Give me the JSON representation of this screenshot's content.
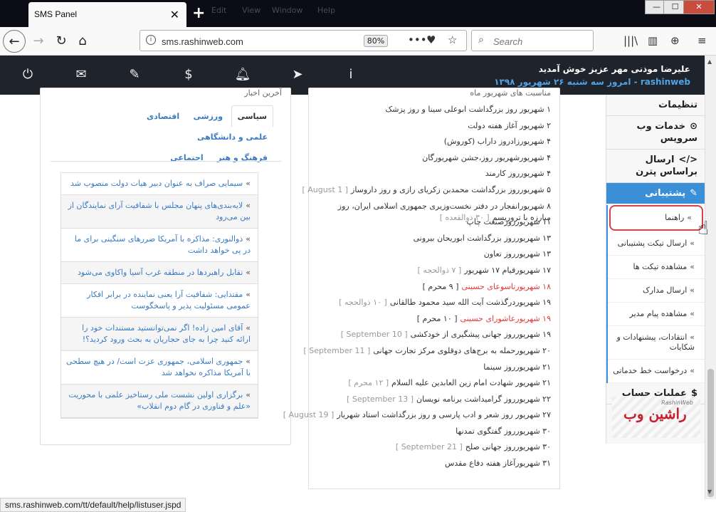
{
  "browser": {
    "tab_title": "SMS Panel",
    "tab_close": "✕",
    "new_tab": "+",
    "menu_items": [
      "Edit",
      "View",
      "Window",
      "Help"
    ],
    "window_controls": {
      "minimize": "—",
      "maximize": "☐",
      "close": "✕"
    },
    "url": "sms.rashinweb.com",
    "zoom": "80%",
    "search_placeholder": "Search",
    "status_url": "sms.rashinweb.com/tt/default/help/listuser.jspd"
  },
  "header": {
    "welcome": "علیرضا موذنی مهر عزیز خوش آمدید",
    "date_line": "rashinweb - امروز سه شنبه ۲۶ شهریور ۱۳۹۸",
    "icons": [
      "power-icon",
      "mail-icon",
      "ticket-icon",
      "dollar-icon",
      "bell-icon",
      "send-icon",
      "info-icon"
    ]
  },
  "news": {
    "title_stub": "آخرین اخبار",
    "tabs": [
      "سیاسی",
      "ورزشی",
      "اقتصادی",
      "علمی و دانشگاهی",
      "فرهنگ و هنر",
      "اجتماعی"
    ],
    "active_tab": 0,
    "items": [
      "سیمایی صراف به عنوان دبیر هیات دولت منصوب شد",
      "لایه‌بندی‌های پنهان مجلس با شفافیت آرای نمایندگان از بین می‌رود",
      "ذوالنوری: مذاکره با آمریکا ضررهای سنگینی برای ما در پی خواهد داشت",
      "تقابل راهبردها در منطقه غرب آسیا واکاوی می‌شود",
      "مقتدایی: شفافیت آرا یعنی نماینده در برابر افکار عمومی مسئولیت پذیر و پاسخگوست",
      "آقای امین زاده! اگر نمی‌توانستید مستندات خود را ارائه کنید چرا به جای حجاریان به بحث ورود کردید؟!",
      "جمهوری اسلامی، جمهوری عزت است/ در هیچ سطحی با آمریکا مذاکره نخواهد شد",
      "برگزاری اولین نشست ملی رستاخیز علمی با محوریت «علم و فناوری در گام دوم انقلاب»"
    ]
  },
  "events": {
    "title_stub": "مناسبت های شهریور ماه",
    "items": [
      {
        "text": "۱ شهریور روز بزرگداشت ابوعلی سینا و روز پزشک",
        "other": "",
        "holiday": false
      },
      {
        "text": "۲ شهریور آغاز هفته دولت",
        "other": "",
        "holiday": false
      },
      {
        "text": "۴ شهریورزادروز داراب (کوروش)",
        "other": "",
        "holiday": false
      },
      {
        "text": "۴ شهریورشهریور روز،جشن شهریورگان",
        "other": "",
        "holiday": false
      },
      {
        "text": "۴ شهریورروز کارمند",
        "other": "",
        "holiday": false
      },
      {
        "text": "۵ شهریورروز بزرگداشت محمدبن زکریای رازی و روز داروساز",
        "other": "[ 1 August ]",
        "holiday": false
      },
      {
        "text": "۸ شهریورانفجار در دفتر نخست‌وزیری جمهوری اسلامی ایران، روز مبارزه با تروریسم",
        "other": "[ ۳۰ ذوالقعده ]",
        "holiday": false
      },
      {
        "text": "۱۱ شهریورروزصنعت چاپ",
        "other": "",
        "holiday": false
      },
      {
        "text": "۱۳ شهریورروز بزرگداشت ابوریحان بیرونی",
        "other": "",
        "holiday": false
      },
      {
        "text": "۱۳ شهریورروز تعاون",
        "other": "",
        "holiday": false
      },
      {
        "text": "۱۷ شهریورقیام ۱۷ شهریور",
        "other": "[ ۷ ذوالحجه ]",
        "holiday": false
      },
      {
        "text": "۱۸ شهریورتاسوعای حسینی",
        "other": "[ ۹ محرم ]",
        "holiday": true
      },
      {
        "text": "۱۹ شهریوردرگذشت آیت الله سید محمود طالقانی",
        "other": "[ ۱۰ ذوالحجه ]",
        "holiday": false
      },
      {
        "text": "۱۹ شهریورعاشورای حسینی",
        "other": "[ ۱۰ محرم ]",
        "holiday": true
      },
      {
        "text": "۱۹ شهریورروز جهانی پیشگیری از خودکشی",
        "other": "[ 10 September ]",
        "holiday": false
      },
      {
        "text": "۲۰ شهریورحمله به برج‌های دوقلوی مرکز تجارت جهانی",
        "other": "[ 11 September ]",
        "holiday": false
      },
      {
        "text": "۲۱ شهریورروز سینما",
        "other": "",
        "holiday": false
      },
      {
        "text": "۲۱ شهریور شهادت امام زین العابدین علیه السلام",
        "other": "[ ۱۲ محرم ]",
        "holiday": false
      },
      {
        "text": "۲۲ شهریورروز گرامیداشت برنامه نویسان",
        "other": "[ 13 September ]",
        "holiday": false
      },
      {
        "text": "۲۷ شهریور روز شعر و ادب پارسی و روز بزرگداشت استاد شهریار",
        "other": "[ 19 August ]",
        "holiday": false
      },
      {
        "text": "۳۰ شهریورروز گفتگوی تمدنها",
        "other": "",
        "holiday": false
      },
      {
        "text": "۳۰ شهریورروز جهانی صلح",
        "other": "[ 21 September ]",
        "holiday": false
      },
      {
        "text": "۳۱ شهریورآغاز هفته دفاع مقدس",
        "other": "",
        "holiday": false
      }
    ]
  },
  "sidebar": {
    "settings": "تنظیمات",
    "web_services": "خدمات وب سرویس",
    "pattern_send": "ارسال براساس پترن",
    "support": "پشتیبانی",
    "support_items": [
      "راهنما",
      "ارسال تیکت پشتیبانی",
      "مشاهده تیکت ها",
      "ارسال مدارک",
      "مشاهده پیام مدیر",
      "انتقادات، پیشنهادات و شکایات",
      "درخواست خط خدماتی"
    ],
    "account_ops": "عملیات حساب",
    "brand_text": "راشین وب",
    "brand_small": "RashinWeb"
  }
}
